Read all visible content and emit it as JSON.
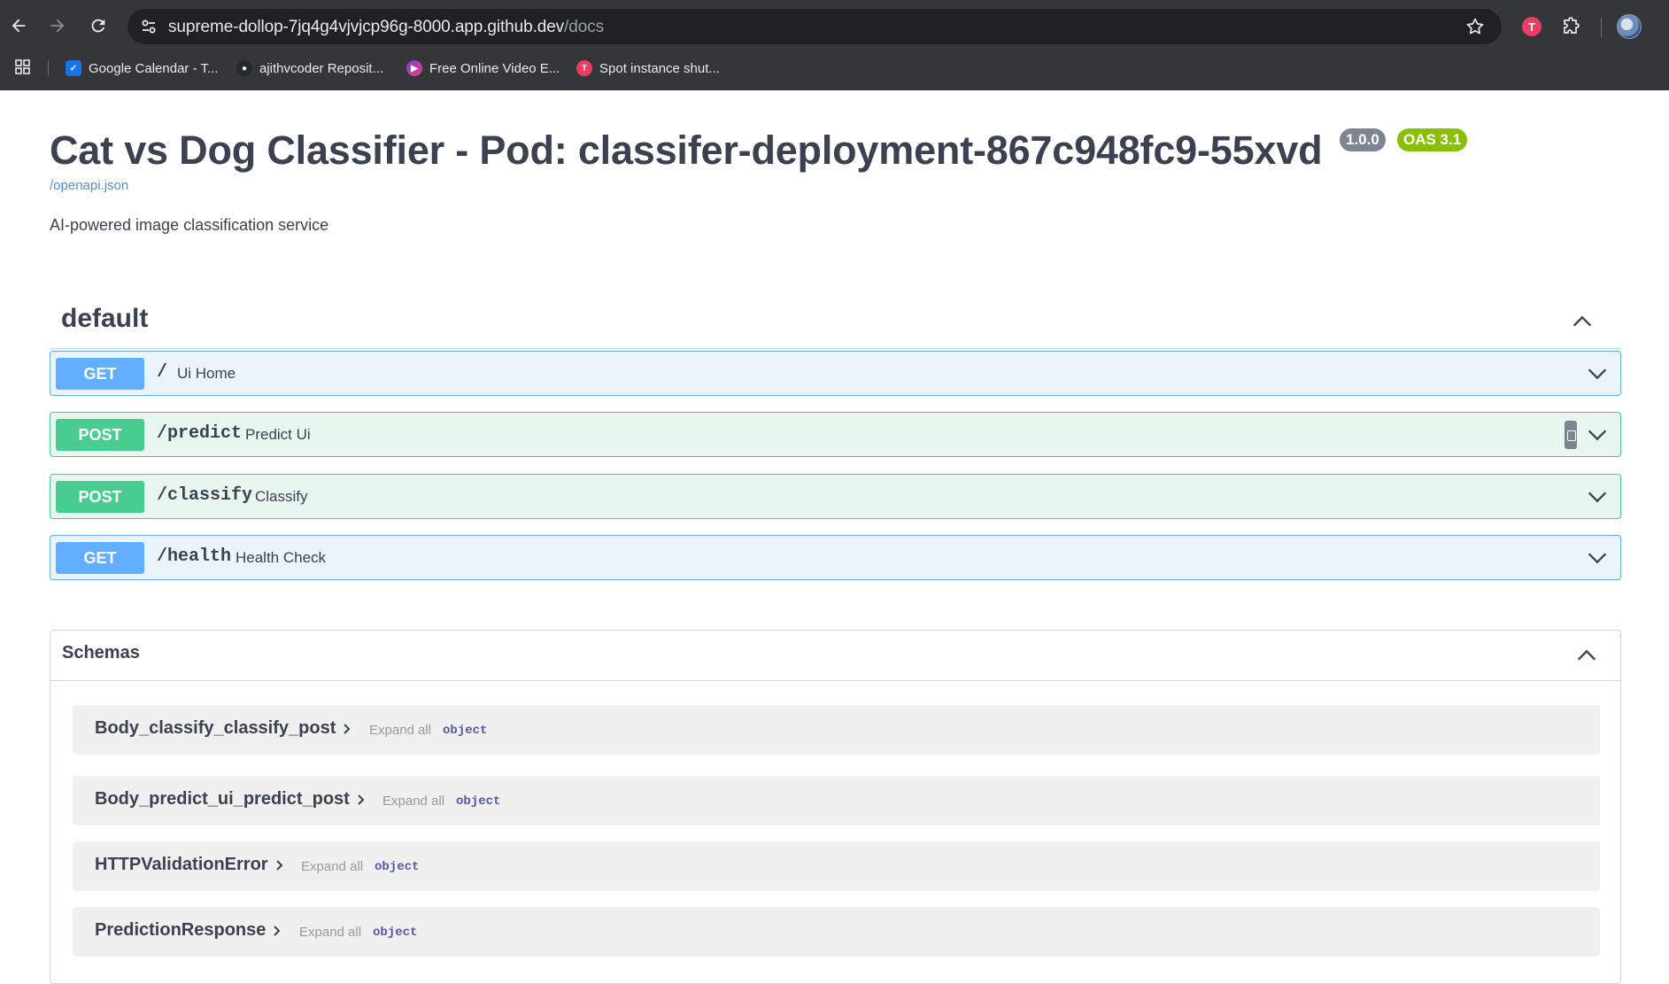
{
  "browser": {
    "url_host": "supreme-dollop-7jq4g4vjvjcp96g-8000.app.github.dev",
    "url_path": "/docs",
    "extension_badge": "T",
    "bookmarks": [
      {
        "label": "Google Calendar - T...",
        "icon": "calendar-icon",
        "color": "#1a73e8"
      },
      {
        "label": "ajithvcoder Reposit...",
        "icon": "github-icon",
        "color": "#5f6368"
      },
      {
        "label": "Free Online Video E...",
        "icon": "video-editor-icon",
        "color": "#b63bd6"
      },
      {
        "label": "Spot instance shut...",
        "icon": "spot-icon",
        "color": "#e83e61"
      }
    ]
  },
  "info": {
    "title": "Cat vs Dog Classifier - Pod: classifer-deployment-867c948fc9-55xvd",
    "version": "1.0.0",
    "oas": "OAS 3.1",
    "openapi_link": "/openapi.json",
    "description": "AI-powered image classification service"
  },
  "tag": {
    "name": "default"
  },
  "operations": [
    {
      "method": "GET",
      "path": "/",
      "summary": "Ui Home"
    },
    {
      "method": "POST",
      "path": "/predict",
      "summary": "Predict Ui"
    },
    {
      "method": "POST",
      "path": "/classify",
      "summary": "Classify"
    },
    {
      "method": "GET",
      "path": "/health",
      "summary": "Health Check"
    }
  ],
  "schemas": {
    "title": "Schemas",
    "models": [
      {
        "name": "Body_classify_classify_post",
        "expand": "Expand all",
        "type": "object"
      },
      {
        "name": "Body_predict_ui_predict_post",
        "expand": "Expand all",
        "type": "object"
      },
      {
        "name": "HTTPValidationError",
        "expand": "Expand all",
        "type": "object"
      },
      {
        "name": "PredictionResponse",
        "expand": "Expand all",
        "type": "object"
      }
    ]
  },
  "colors": {
    "get": "#61affe",
    "post": "#49cc90",
    "version_badge": "#7d8492",
    "oas_badge": "#89bf04",
    "link": "#4990e2"
  }
}
